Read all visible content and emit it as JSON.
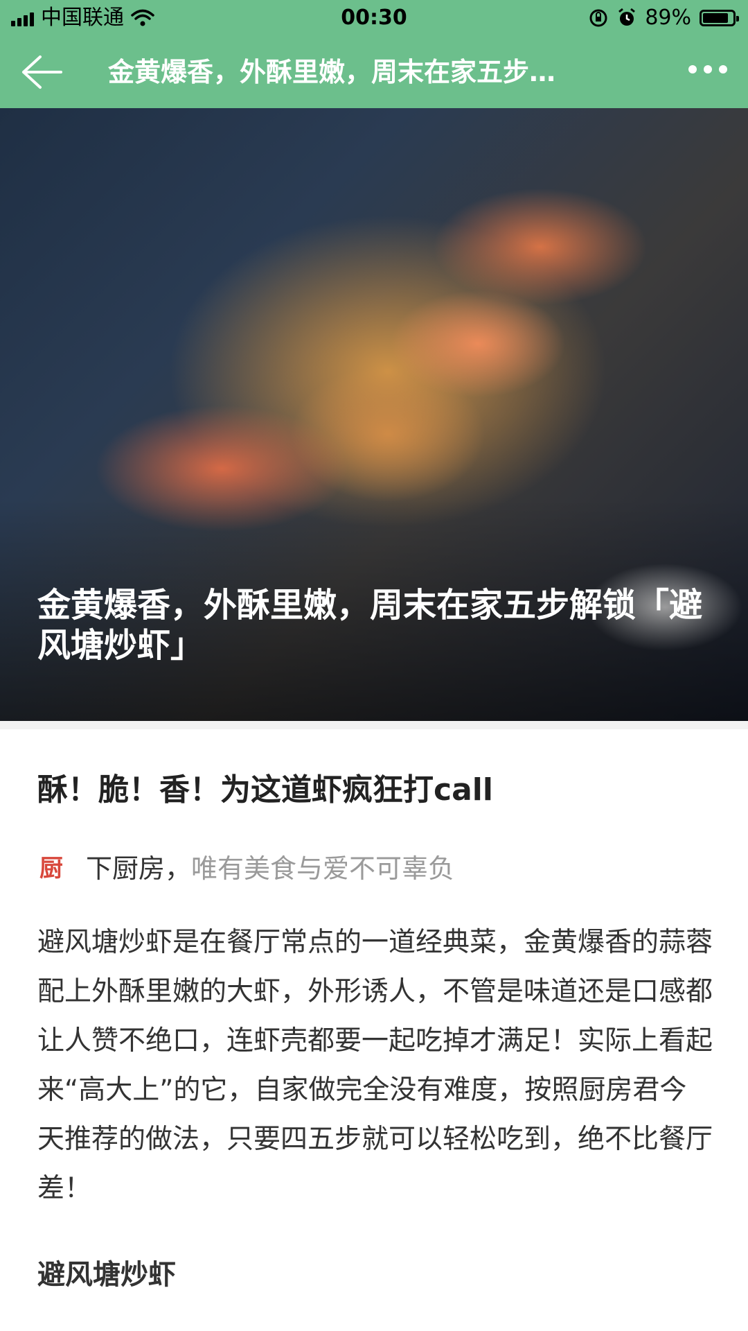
{
  "status_bar": {
    "carrier": "中国联通",
    "time": "00:30",
    "battery": "89%",
    "battery_level": 0.89
  },
  "nav": {
    "title": "金黄爆香，外酥里嫩，周末在家五步…"
  },
  "hero": {
    "title": "金黄爆香，外酥里嫩，周末在家五步解锁「避风塘炒虾」"
  },
  "article": {
    "subtitle": "酥！脆！香！为这道虾疯狂打call",
    "logo_char": "厨",
    "source_name": "下厨房，",
    "source_slogan": "唯有美食与爱不可辜负",
    "body": "避风塘炒虾是在餐厅常点的一道经典菜，金黄爆香的蒜蓉配上外酥里嫩的大虾，外形诱人，不管是味道还是口感都让人赞不绝口，连虾壳都要一起吃掉才满足！实际上看起来“高大上”的它，自家做完全没有难度，按照厨房君今天推荐的做法，只要四五步就可以轻松吃到，绝不比餐厅差！",
    "section_title": "避风塘炒虾"
  },
  "colors": {
    "topbar": "#6cbf8c",
    "logo": "#d8473b"
  },
  "icons": {
    "back": "arrow-left",
    "more": "ellipsis",
    "wifi": "wifi",
    "alarm": "alarm-clock",
    "lock": "rotation-lock"
  }
}
